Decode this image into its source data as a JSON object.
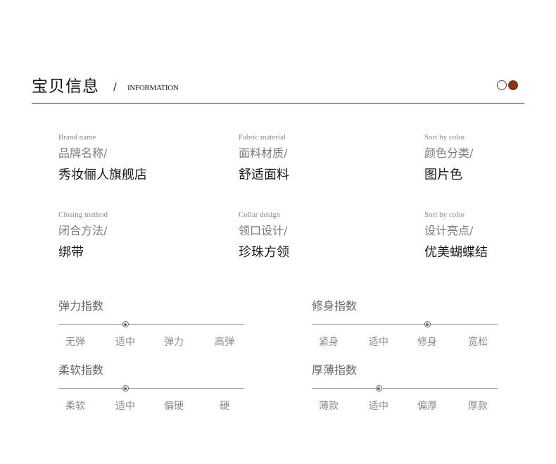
{
  "header": {
    "title": "宝贝信息",
    "slash": "/",
    "subtitle": "INFORMATION",
    "accent_colors": [
      "#5a3f30",
      "#8a3413"
    ]
  },
  "attributes": [
    {
      "en": "Brand name",
      "zh": "品牌名称/",
      "value": "秀妆俪人旗舰店"
    },
    {
      "en": "Fabric material",
      "zh": "面料材质/",
      "value": "舒适面料"
    },
    {
      "en": "Sort by color",
      "zh": "颜色分类/",
      "value": "图片色"
    },
    {
      "en": "Closing method",
      "zh": "闭合方法/",
      "value": "绑带"
    },
    {
      "en": "Collar design",
      "zh": "领口设计/",
      "value": "珍珠方领"
    },
    {
      "en": "Sort by color",
      "zh": "设计亮点/",
      "value": "优美蝴蝶结"
    }
  ],
  "indexes": [
    {
      "title": "弹力指数",
      "options": [
        "无弹",
        "适中",
        "弹力",
        "高弹"
      ],
      "selected": "适中"
    },
    {
      "title": "修身指数",
      "options": [
        "紧身",
        "适中",
        "修身",
        "宽松"
      ],
      "selected": "修身"
    },
    {
      "title": "柔软指数",
      "options": [
        "柔软",
        "适中",
        "偏硬",
        "硬"
      ],
      "selected": "适中"
    },
    {
      "title": "厚薄指数",
      "options": [
        "薄款",
        "适中",
        "偏厚",
        "厚款"
      ],
      "selected": "适中"
    }
  ]
}
